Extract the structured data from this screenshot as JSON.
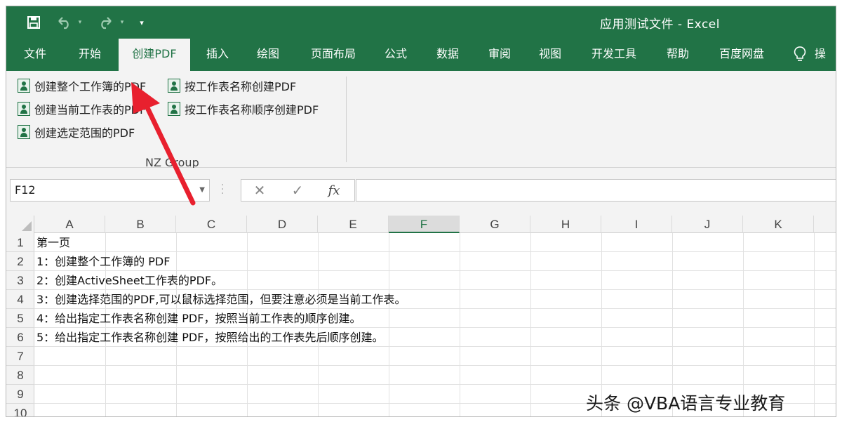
{
  "window": {
    "title": "应用测试文件  -  Excel"
  },
  "quick_access": {
    "icons": [
      "save-icon",
      "undo-icon",
      "redo-icon",
      "customize-icon"
    ]
  },
  "tabs": [
    {
      "label": "文件"
    },
    {
      "label": "开始"
    },
    {
      "label": "创建PDF"
    },
    {
      "label": "插入"
    },
    {
      "label": "绘图"
    },
    {
      "label": "页面布局"
    },
    {
      "label": "公式"
    },
    {
      "label": "数据"
    },
    {
      "label": "审阅"
    },
    {
      "label": "视图"
    },
    {
      "label": "开发工具"
    },
    {
      "label": "帮助"
    },
    {
      "label": "百度网盘"
    },
    {
      "label": "操"
    }
  ],
  "active_tab": "创建PDF",
  "ribbon": {
    "buttons": [
      {
        "label": "创建整个工作簿的PDF"
      },
      {
        "label": "创建当前工作表的PDF"
      },
      {
        "label": "创建选定范围的PDF"
      },
      {
        "label": "按工作表名称创建PDF"
      },
      {
        "label": "按工作表名称顺序创建PDF"
      }
    ],
    "group_label": "NZ Group"
  },
  "formula_bar": {
    "name_box": "F12",
    "cancel_symbol": "✕",
    "enter_symbol": "✓",
    "fx_symbol": "fx",
    "formula": ""
  },
  "sheet": {
    "columns": [
      "A",
      "B",
      "C",
      "D",
      "E",
      "F",
      "G",
      "H",
      "I",
      "J",
      "K"
    ],
    "selected_column": "F",
    "rows": [
      "1",
      "2",
      "3",
      "4",
      "5",
      "6",
      "7",
      "8",
      "9",
      "10"
    ],
    "cells_col_a": [
      "第一页",
      "1：创建整个工作簿的 PDF",
      "2：创建ActiveSheet工作表的PDF。",
      "3：创建选择范围的PDF,可以鼠标选择范围，但要注意必须是当前工作表。",
      "4：给出指定工作表名称创建 PDF，按照当前工作表的顺序创建。",
      "5：给出指定工作表名称创建 PDF，按照给出的工作表先后顺序创建。",
      "",
      "",
      "",
      ""
    ]
  },
  "watermark": "头条 @VBA语言专业教育",
  "colors": {
    "excel_green": "#217346",
    "arrow_red": "#e8202e"
  }
}
